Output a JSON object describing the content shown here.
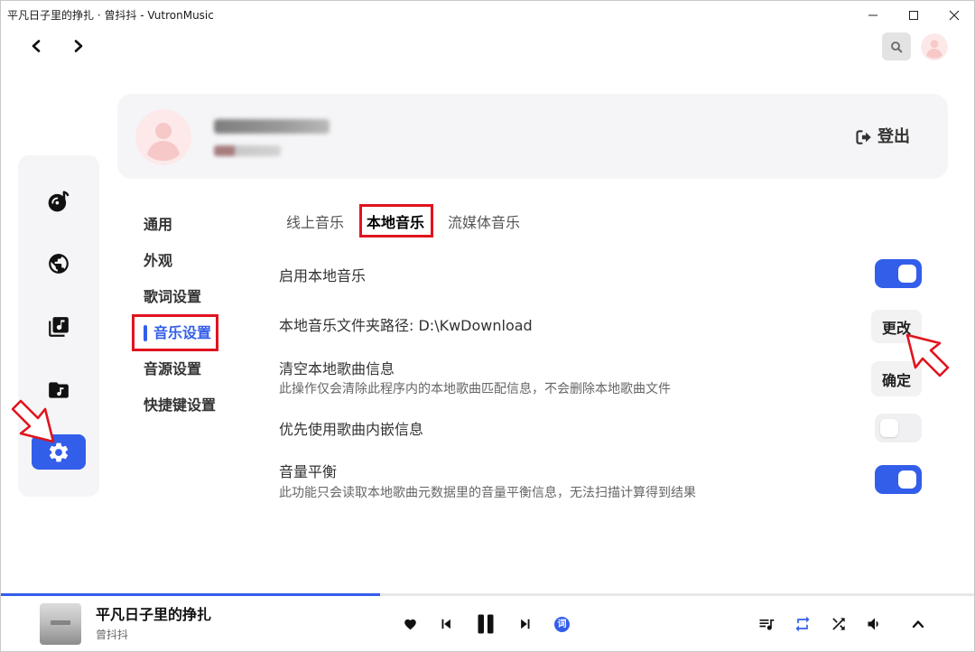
{
  "window": {
    "title": "平凡日子里的挣扎 · 曾抖抖 - VutronMusic",
    "controls": [
      "minimize-icon",
      "maximize-icon",
      "close-icon"
    ]
  },
  "topbar": {
    "back_icon": "chevron-left-icon",
    "forward_icon": "chevron-right-icon",
    "search_icon": "search-icon",
    "avatar_icon": "avatar-icon"
  },
  "sidebar": {
    "items": [
      {
        "icon": "music-disc-icon"
      },
      {
        "icon": "globe-icon"
      },
      {
        "icon": "music-library-icon"
      },
      {
        "icon": "music-folder-icon"
      },
      {
        "icon": "gear-icon",
        "active": true
      }
    ]
  },
  "account": {
    "logout_icon": "logout-icon",
    "logout_label": "登出"
  },
  "settings_nav": {
    "items": [
      {
        "label": "通用"
      },
      {
        "label": "外观"
      },
      {
        "label": "歌词设置"
      },
      {
        "label": "音乐设置",
        "active": true
      },
      {
        "label": "音源设置"
      },
      {
        "label": "快捷键设置"
      }
    ]
  },
  "tabs": {
    "items": [
      {
        "label": "线上音乐"
      },
      {
        "label": "本地音乐",
        "active": true
      },
      {
        "label": "流媒体音乐"
      }
    ]
  },
  "settings": [
    {
      "label": "启用本地音乐",
      "control": "toggle",
      "enabled": true
    },
    {
      "label": "本地音乐文件夹路径: D:\\KwDownload",
      "control": "button",
      "button_label": "更改"
    },
    {
      "label": "清空本地歌曲信息",
      "description": "此操作仅会清除此程序内的本地歌曲匹配信息，不会删除本地歌曲文件",
      "control": "button",
      "button_label": "确定"
    },
    {
      "label": "优先使用歌曲内嵌信息",
      "control": "toggle",
      "enabled": false
    },
    {
      "label": "音量平衡",
      "description": "此功能只会读取本地歌曲元数据里的音量平衡信息，无法扫描计算得到结果",
      "control": "toggle",
      "enabled": true
    }
  ],
  "player": {
    "progress": 0.39,
    "track_title": "平凡日子里的挣扎",
    "artist": "曾抖抖",
    "lyrics_button_label": "词",
    "repeat_active": true,
    "icons": {
      "like": "heart-icon",
      "previous": "skip-previous-icon",
      "play_pause": "pause-icon",
      "next": "skip-next-icon",
      "playlist": "queue-music-icon",
      "repeat": "repeat-icon",
      "shuffle": "shuffle-icon",
      "volume": "volume-icon",
      "expand": "chevron-up-icon"
    }
  },
  "colors": {
    "accent": "#335eea",
    "annotation": "#e0141e",
    "panel": "#f5f5f7"
  }
}
